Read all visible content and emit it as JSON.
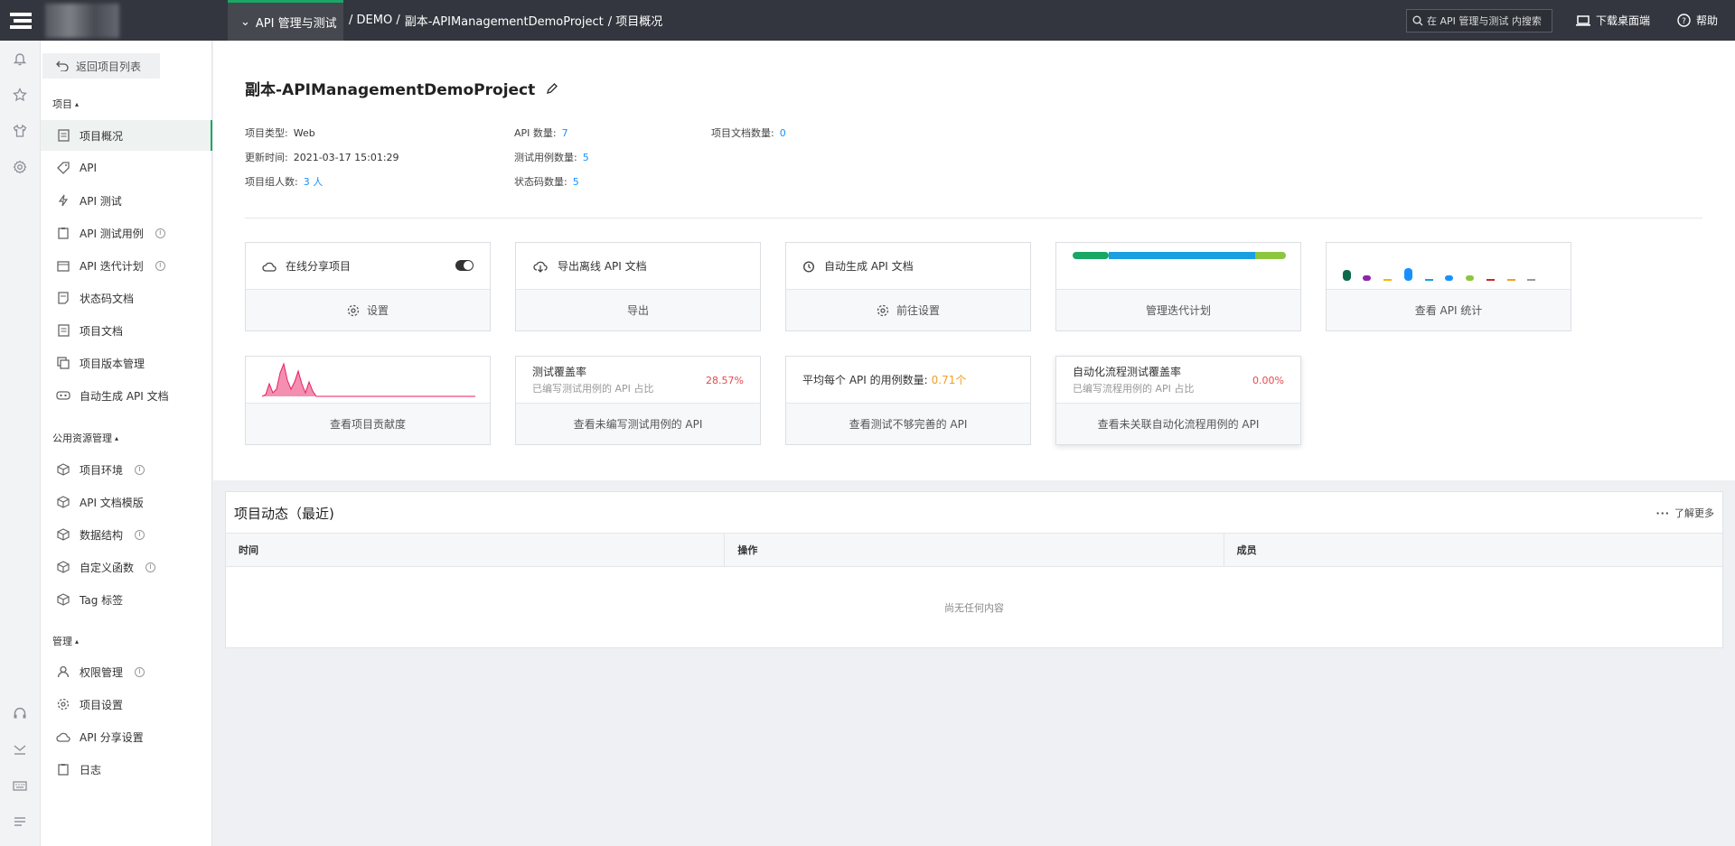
{
  "topbar": {
    "module": "API 管理与测试",
    "breadcrumb": [
      "/ DEMO /",
      "副本-APIManagementDemoProject",
      "/ 项目概况"
    ],
    "search_placeholder": "在 API 管理与测试 内搜索",
    "download": "下载桌面端",
    "help": "帮助"
  },
  "sidebar": {
    "back": "返回项目列表",
    "sections": [
      {
        "title": "项目",
        "items": [
          "项目概况",
          "API",
          "API 测试",
          "API 测试用例",
          "API 迭代计划",
          "状态码文档",
          "项目文档",
          "项目版本管理",
          "自动生成 API 文档"
        ]
      },
      {
        "title": "公用资源管理",
        "items": [
          "项目环境",
          "API 文档模版",
          "数据结构",
          "自定义函数",
          "Tag 标签"
        ]
      },
      {
        "title": "管理",
        "items": [
          "权限管理",
          "项目设置",
          "API 分享设置",
          "日志"
        ]
      }
    ]
  },
  "project": {
    "title": "副本-APIManagementDemoProject",
    "type_label": "项目类型:",
    "type_value": "Web",
    "updated_label": "更新时间:",
    "updated_value": "2021-03-17 15:01:29",
    "members_label": "项目组人数:",
    "members_value": "3 人",
    "api_count_label": "API 数量:",
    "api_count_value": "7",
    "case_count_label": "测试用例数量:",
    "case_count_value": "5",
    "status_count_label": "状态码数量:",
    "status_count_value": "5",
    "doc_count_label": "项目文档数量:",
    "doc_count_value": "0"
  },
  "cards": {
    "share_label": "在线分享项目",
    "share_action": "设置",
    "export_label": "导出离线 API 文档",
    "export_action": "导出",
    "autogen_label": "自动生成 API 文档",
    "autogen_action": "前往设置",
    "iteration_action": "管理迭代计划",
    "stats_action": "查看 API 统计",
    "contrib_action": "查看项目贡献度",
    "coverage_title": "测试覆盖率",
    "coverage_sub": "已编写测试用例的 API 占比",
    "coverage_value": "28.57%",
    "coverage_action": "查看未编写测试用例的 API",
    "avg_title": "平均每个 API 的用例数量:",
    "avg_value": "0.71个",
    "avg_action": "查看测试不够完善的 API",
    "auto_title": "自动化流程测试覆盖率",
    "auto_sub": "已编写流程用例的 API 占比",
    "auto_value": "0.00%",
    "auto_action": "查看未关联自动化流程用例的 API"
  },
  "activity": {
    "title": "项目动态（最近)",
    "more": "了解更多",
    "columns": [
      "时间",
      "操作",
      "成员"
    ],
    "empty": "尚无任何内容"
  },
  "colors": {
    "accent": "#1aa766",
    "link": "#1890ff",
    "danger": "#e5484d",
    "warning": "#f0a020",
    "topbar": "#33363e"
  }
}
